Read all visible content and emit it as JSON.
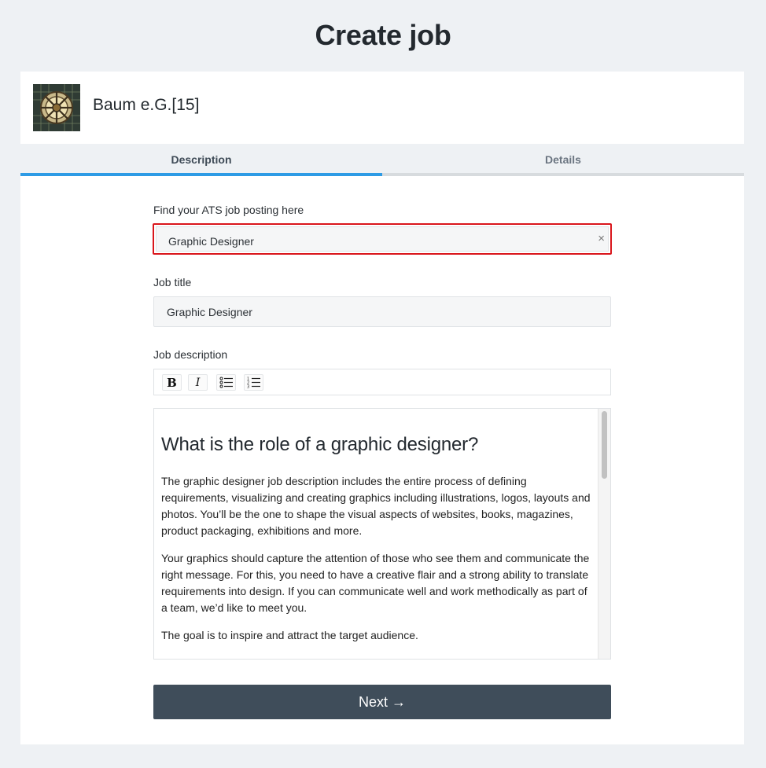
{
  "page": {
    "title": "Create job"
  },
  "company": {
    "name": "Baum e.G.[15]",
    "logo_icon": "stained-glass-dome-logo"
  },
  "tabs": [
    {
      "label": "Description",
      "active": true
    },
    {
      "label": "Details",
      "active": false
    }
  ],
  "form": {
    "ats": {
      "label": "Find your ATS job posting here",
      "value": "Graphic Designer",
      "clear_symbol": "×"
    },
    "job_title": {
      "label": "Job title",
      "value": "Graphic Designer"
    },
    "job_description": {
      "label": "Job description",
      "toolbar": {
        "bold": "B",
        "italic": "I",
        "bullet_list_icon": "bullet-list-icon",
        "numbered_list_icon": "numbered-list-icon"
      },
      "heading": "What is the role of a graphic designer?",
      "paragraphs": [
        "The graphic designer job description includes the entire process of defining requirements, visualizing and creating graphics including illustrations, logos, layouts and photos. You’ll be the one to shape the visual aspects of websites, books, magazines, product packaging, exhibitions and more.",
        "Your graphics should capture the attention of those who see them and communicate the right message. For this, you need to have a creative flair and a strong ability to translate requirements into design. If you can communicate well and work methodically as part of a team, we’d like to meet you.",
        "The goal is to inspire and attract the target audience."
      ]
    },
    "next_label": "Next →"
  },
  "colors": {
    "background": "#eef1f4",
    "active_tab": "#2d9be5",
    "highlight_border": "#d9151b",
    "button": "#3f4d5a"
  }
}
